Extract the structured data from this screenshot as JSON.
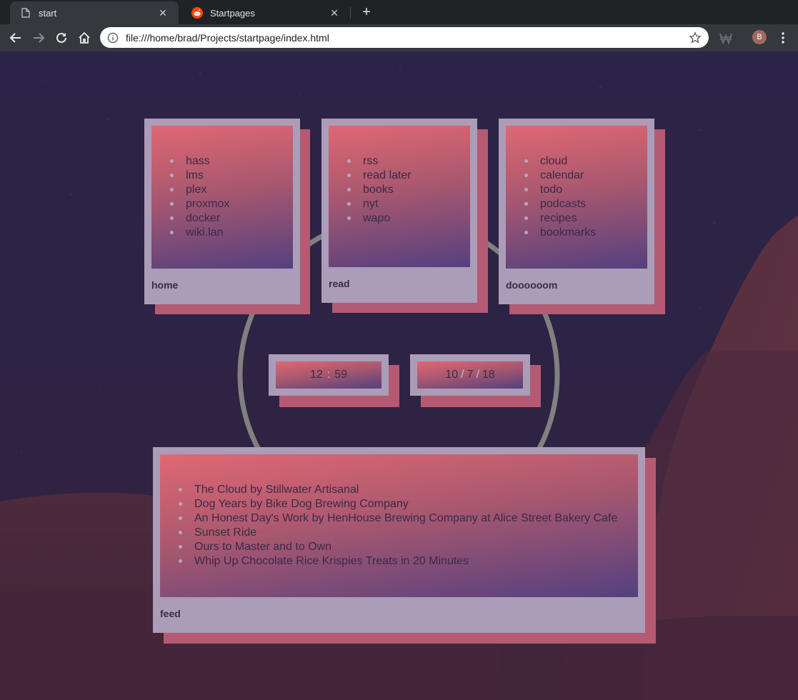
{
  "browser": {
    "tabs": [
      {
        "title": "start",
        "icon": "document-icon",
        "active": true
      },
      {
        "title": "Startpages",
        "icon": "reddit-icon",
        "active": false
      }
    ],
    "new_tab_symbol": "+",
    "close_symbol": "✕",
    "url": "file:///home/brad/Projects/startpage/index.html",
    "profile_initial": "B"
  },
  "colors": {
    "frame": "#ab9cb8",
    "shadow": "#b45a72",
    "gradient_top": "#e06872",
    "gradient_bottom": "#55407f",
    "text": "#3a2a48",
    "ring": "#808080"
  },
  "cards": {
    "home": {
      "label": "home",
      "links": [
        "hass",
        "lms",
        "plex",
        "proxmox",
        "docker",
        "wiki.lan"
      ]
    },
    "read": {
      "label": "read",
      "links": [
        "rss",
        "read later",
        "books",
        "nyt",
        "wapo"
      ]
    },
    "doom": {
      "label": "doooooom",
      "links": [
        "cloud",
        "calendar",
        "todo",
        "podcasts",
        "recipes",
        "bookmarks"
      ]
    },
    "feed": {
      "label": "feed",
      "links": [
        "The Cloud by Stillwater Artisanal",
        "Dog Years by Bike Dog Brewing Company",
        "An Honest Day's Work by HenHouse Brewing Company at Alice Street Bakery Cafe",
        "Sunset Ride",
        "Ours to Master and to Own",
        "Whip Up Chocolate Rice Krispies Treats in 20 Minutes"
      ]
    }
  },
  "clock": {
    "hours": "12",
    "minutes": "59",
    "separator": ":"
  },
  "date": {
    "month": "10",
    "day": "7",
    "year": "18",
    "separator": "/"
  }
}
